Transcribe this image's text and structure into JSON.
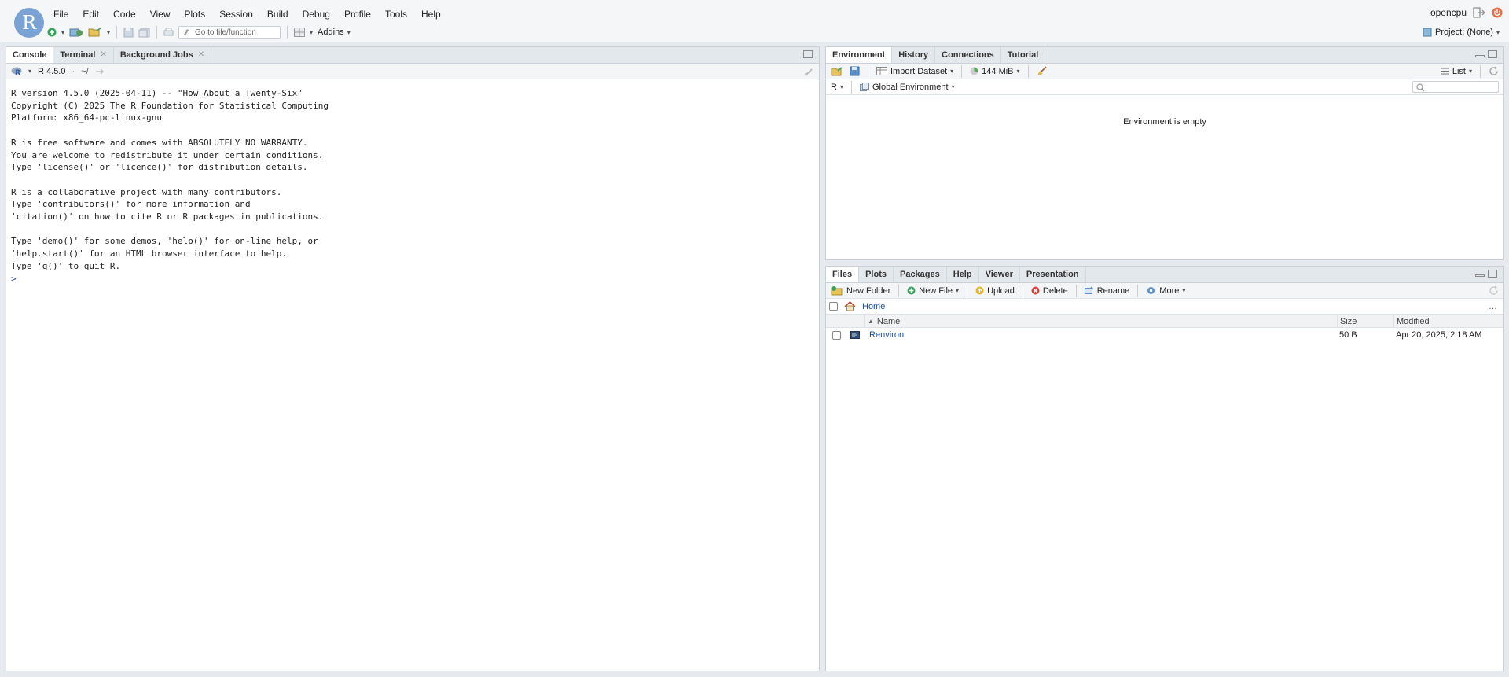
{
  "menubar": {
    "logo": "R",
    "items": [
      "File",
      "Edit",
      "Code",
      "View",
      "Plots",
      "Session",
      "Build",
      "Debug",
      "Profile",
      "Tools",
      "Help"
    ],
    "user": "opencpu"
  },
  "toolbar": {
    "goto_placeholder": "Go to file/function",
    "addins": "Addins",
    "project": "Project: (None)"
  },
  "console_pane": {
    "tabs": [
      "Console",
      "Terminal",
      "Background Jobs"
    ],
    "r_version": "R 4.5.0",
    "wd": "~/",
    "output": "R version 4.5.0 (2025-04-11) -- \"How About a Twenty-Six\"\nCopyright (C) 2025 The R Foundation for Statistical Computing\nPlatform: x86_64-pc-linux-gnu\n\nR is free software and comes with ABSOLUTELY NO WARRANTY.\nYou are welcome to redistribute it under certain conditions.\nType 'license()' or 'licence()' for distribution details.\n\nR is a collaborative project with many contributors.\nType 'contributors()' for more information and\n'citation()' on how to cite R or R packages in publications.\n\nType 'demo()' for some demos, 'help()' for on-line help, or\n'help.start()' for an HTML browser interface to help.\nType 'q()' to quit R.\n",
    "prompt": ">"
  },
  "env_pane": {
    "tabs": [
      "Environment",
      "History",
      "Connections",
      "Tutorial"
    ],
    "import_dataset": "Import Dataset",
    "memory": "144 MiB",
    "view_mode": "List",
    "language": "R",
    "scope": "Global Environment",
    "empty_message": "Environment is empty"
  },
  "files_pane": {
    "tabs": [
      "Files",
      "Plots",
      "Packages",
      "Help",
      "Viewer",
      "Presentation"
    ],
    "toolbar": {
      "new_folder": "New Folder",
      "new_file": "New File",
      "upload": "Upload",
      "delete": "Delete",
      "rename": "Rename",
      "more": "More"
    },
    "path": "Home",
    "columns": [
      "Name",
      "Size",
      "Modified"
    ],
    "files": [
      {
        "name": ".Renviron",
        "size": "50 B",
        "modified": "Apr 20, 2025, 2:18 AM"
      }
    ]
  }
}
